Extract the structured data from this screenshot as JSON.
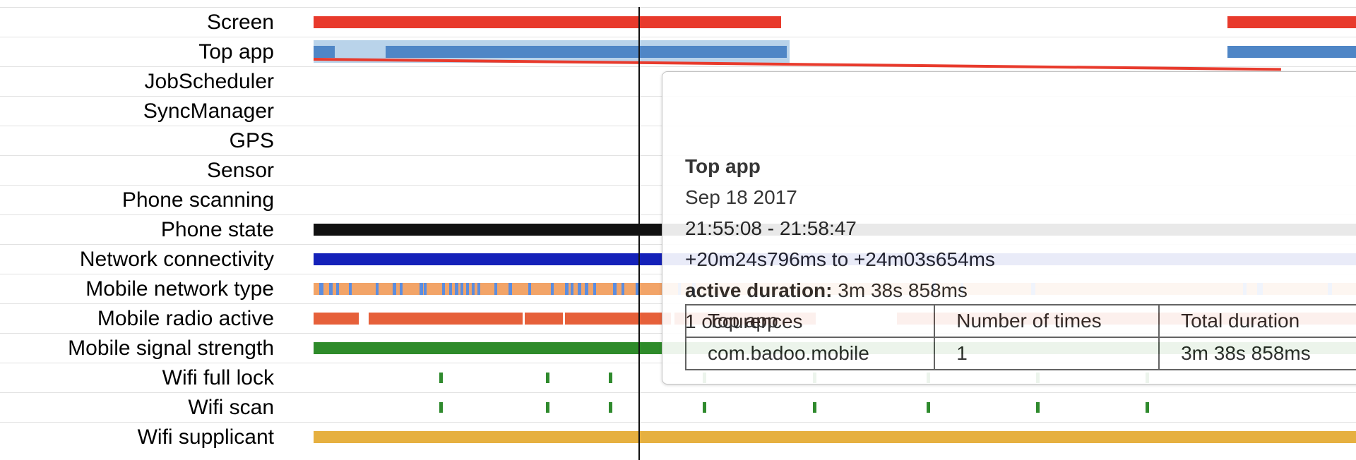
{
  "colors": {
    "screen": "#e83a2c",
    "top_app": "#4f86c6",
    "top_app_highlight": "#b9d3ea",
    "phone_state": "#111111",
    "network_connectivity": "#1421b9",
    "mobile_network_type_base": "#f2a468",
    "mobile_network_type_alt": "#5b8de0",
    "mobile_radio_active": "#e6603a",
    "mobile_signal_strength": "#2e8b2a",
    "wifi_tick": "#2f8a2d",
    "wifi_supplicant": "#e6b040",
    "cursor": "#111111"
  },
  "rows": [
    {
      "key": "screen",
      "label": "Screen"
    },
    {
      "key": "top_app",
      "label": "Top app"
    },
    {
      "key": "jobscheduler",
      "label": "JobScheduler"
    },
    {
      "key": "syncmanager",
      "label": "SyncManager"
    },
    {
      "key": "gps",
      "label": "GPS"
    },
    {
      "key": "sensor",
      "label": "Sensor"
    },
    {
      "key": "phone_scanning",
      "label": "Phone scanning"
    },
    {
      "key": "phone_state",
      "label": "Phone state"
    },
    {
      "key": "network_connectivity",
      "label": "Network connectivity"
    },
    {
      "key": "mobile_network_type",
      "label": "Mobile network type"
    },
    {
      "key": "mobile_radio_active",
      "label": "Mobile radio active"
    },
    {
      "key": "mobile_signal_strength",
      "label": "Mobile signal strength"
    },
    {
      "key": "wifi_full_lock",
      "label": "Wifi full lock"
    },
    {
      "key": "wifi_scan",
      "label": "Wifi scan"
    },
    {
      "key": "wifi_supplicant",
      "label": "Wifi supplicant"
    }
  ],
  "tooltip": {
    "title": "Top app",
    "date": "Sep 18 2017",
    "time_range": "21:55:08 - 21:58:47",
    "offset_range": "+20m24s796ms to +24m03s654ms",
    "active_duration_label": "active duration:",
    "active_duration_value": "3m 38s 858ms",
    "occurrences": "1 occurences",
    "table": {
      "headers": [
        "Top app",
        "Number of times",
        "Total duration"
      ],
      "rows": [
        [
          "com.badoo.mobile",
          "1",
          "3m 38s 858ms"
        ]
      ]
    }
  }
}
